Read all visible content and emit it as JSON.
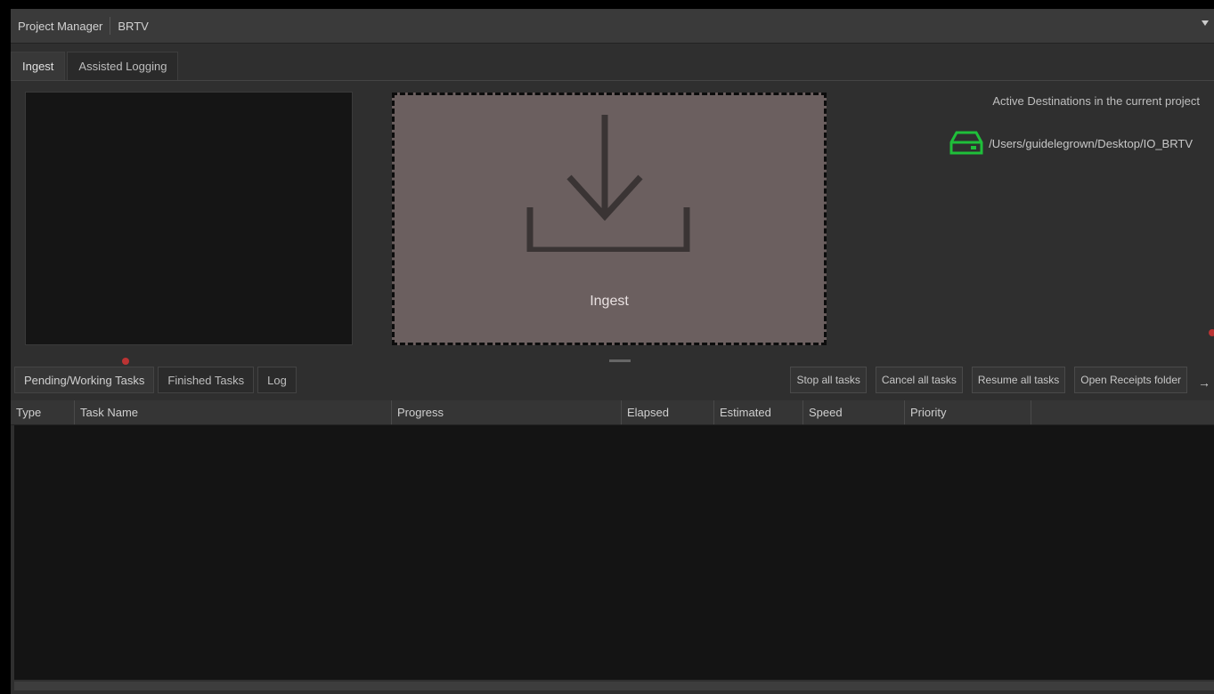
{
  "project_bar": {
    "label": "Project Manager",
    "project_name": "BRTV"
  },
  "tabs": [
    {
      "label": "Ingest"
    },
    {
      "label": "Assisted Logging"
    }
  ],
  "drop_zone": {
    "label": "Ingest",
    "icon": "download-icon"
  },
  "destinations": {
    "title": "Active Destinations in the current project",
    "items": [
      {
        "path": "/Users/guidelegrown/Desktop/IO_BRTV",
        "icon": "drive-icon",
        "color": "#1fbf3a"
      }
    ]
  },
  "task_tabs": [
    {
      "label": "Pending/Working Tasks"
    },
    {
      "label": "Finished Tasks"
    },
    {
      "label": "Log"
    }
  ],
  "task_actions": [
    {
      "label": "Stop all tasks"
    },
    {
      "label": "Cancel all tasks"
    },
    {
      "label": "Resume all tasks"
    },
    {
      "label": "Open Receipts folder"
    }
  ],
  "table": {
    "columns": [
      "Type",
      "Task Name",
      "Progress",
      "Elapsed",
      "Estimated",
      "Speed",
      "Priority"
    ]
  }
}
